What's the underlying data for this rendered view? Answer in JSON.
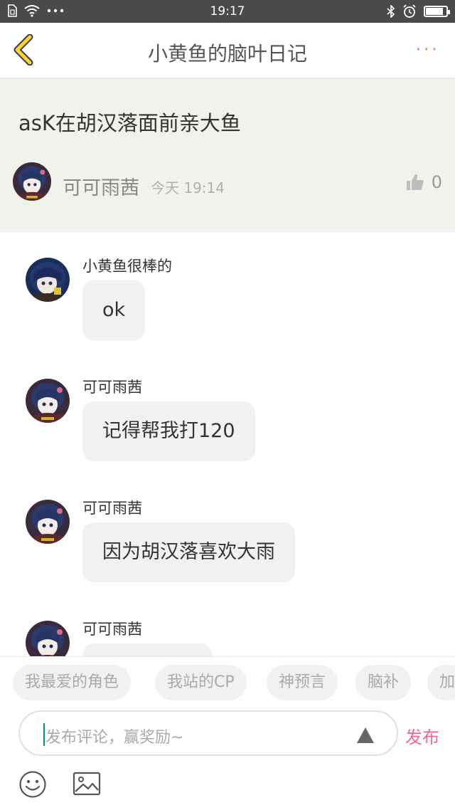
{
  "status_bar": {
    "time": "19:17",
    "left_icons": [
      "sim-icon",
      "wifi-icon",
      "more-dots-icon"
    ],
    "right_icons": [
      "bluetooth-icon",
      "alarm-icon",
      "battery-icon"
    ],
    "battery_level": 0.85
  },
  "nav": {
    "title": "小黄鱼的脑叶日记",
    "back_icon": "chevron-left-icon",
    "more_label": "···",
    "accent_color": "#f08a5d"
  },
  "post": {
    "title": "asK在胡汉落面前亲大鱼",
    "author": "可可雨茜",
    "time": "今天 19:14",
    "like_count": "0",
    "background": "#f0f2ec"
  },
  "comments": [
    {
      "author": "小黄鱼很棒的",
      "text": "ok"
    },
    {
      "author": "可可雨茜",
      "text": "记得帮我打120"
    },
    {
      "author": "可可雨茜",
      "text": "因为胡汉落喜欢大雨"
    },
    {
      "author": "可可雨茜",
      "text": ""
    }
  ],
  "tags": [
    "我最爱的角色",
    "我站的CP",
    "神预言",
    "脑补",
    "加"
  ],
  "input": {
    "placeholder": "发布评论，赢奖励~",
    "publish_label": "发布",
    "publish_color": "#e8699a"
  },
  "toolbar": {
    "icons": [
      "emoji-icon",
      "image-icon"
    ]
  }
}
